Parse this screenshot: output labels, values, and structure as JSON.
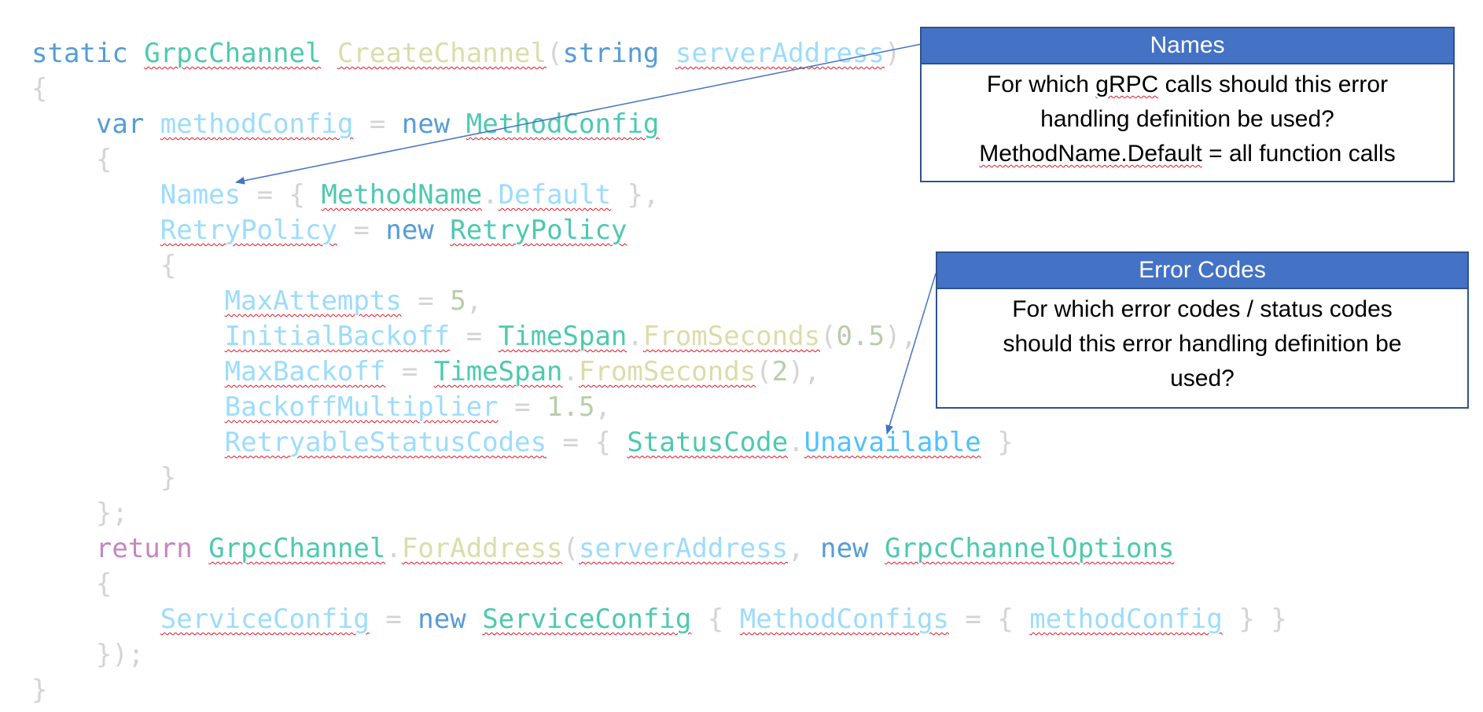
{
  "code": {
    "lines": [
      [
        {
          "t": "static ",
          "c": "kw"
        },
        {
          "t": "GrpcChannel",
          "c": "type",
          "sq": true
        },
        {
          "t": " ",
          "c": "pun"
        },
        {
          "t": "CreateChannel",
          "c": "fn",
          "sq": true
        },
        {
          "t": "(",
          "c": "pun"
        },
        {
          "t": "string",
          "c": "kw"
        },
        {
          "t": " ",
          "c": "pun"
        },
        {
          "t": "serverAddress",
          "c": "var",
          "sq": true
        },
        {
          "t": ")",
          "c": "pun"
        }
      ],
      [
        {
          "t": "{",
          "c": "pun"
        }
      ],
      [
        {
          "t": "    ",
          "c": "pun"
        },
        {
          "t": "var",
          "c": "kw"
        },
        {
          "t": " ",
          "c": "pun"
        },
        {
          "t": "methodConfig",
          "c": "var",
          "sq": true
        },
        {
          "t": " = ",
          "c": "pun"
        },
        {
          "t": "new",
          "c": "kw"
        },
        {
          "t": " ",
          "c": "pun"
        },
        {
          "t": "MethodConfig",
          "c": "type",
          "sq": true
        }
      ],
      [
        {
          "t": "    {",
          "c": "pun"
        }
      ],
      [
        {
          "t": "        ",
          "c": "pun"
        },
        {
          "t": "Names",
          "c": "var"
        },
        {
          "t": " = { ",
          "c": "pun"
        },
        {
          "t": "MethodName",
          "c": "type",
          "sq": true
        },
        {
          "t": ".",
          "c": "pun"
        },
        {
          "t": "Default",
          "c": "var",
          "sq": true
        },
        {
          "t": " },",
          "c": "pun"
        }
      ],
      [
        {
          "t": "        ",
          "c": "pun"
        },
        {
          "t": "RetryPolicy",
          "c": "var",
          "sq": true
        },
        {
          "t": " = ",
          "c": "pun"
        },
        {
          "t": "new",
          "c": "kw"
        },
        {
          "t": " ",
          "c": "pun"
        },
        {
          "t": "RetryPolicy",
          "c": "type",
          "sq": true
        }
      ],
      [
        {
          "t": "        {",
          "c": "pun"
        }
      ],
      [
        {
          "t": "            ",
          "c": "pun"
        },
        {
          "t": "MaxAttempts",
          "c": "var",
          "sq": true
        },
        {
          "t": " = ",
          "c": "pun"
        },
        {
          "t": "5",
          "c": "num"
        },
        {
          "t": ",",
          "c": "pun"
        }
      ],
      [
        {
          "t": "            ",
          "c": "pun"
        },
        {
          "t": "InitialBackoff",
          "c": "var",
          "sq": true
        },
        {
          "t": " = ",
          "c": "pun"
        },
        {
          "t": "TimeSpan",
          "c": "type",
          "sq": true
        },
        {
          "t": ".",
          "c": "pun"
        },
        {
          "t": "FromSeconds",
          "c": "fn",
          "sq": true
        },
        {
          "t": "(",
          "c": "pun"
        },
        {
          "t": "0.5",
          "c": "num"
        },
        {
          "t": "),",
          "c": "pun"
        }
      ],
      [
        {
          "t": "            ",
          "c": "pun"
        },
        {
          "t": "MaxBackoff",
          "c": "var",
          "sq": true
        },
        {
          "t": " = ",
          "c": "pun"
        },
        {
          "t": "TimeSpan",
          "c": "type",
          "sq": true
        },
        {
          "t": ".",
          "c": "pun"
        },
        {
          "t": "FromSeconds",
          "c": "fn",
          "sq": true
        },
        {
          "t": "(",
          "c": "pun"
        },
        {
          "t": "2",
          "c": "num"
        },
        {
          "t": "),",
          "c": "pun"
        }
      ],
      [
        {
          "t": "            ",
          "c": "pun"
        },
        {
          "t": "BackoffMultiplier",
          "c": "var",
          "sq": true
        },
        {
          "t": " = ",
          "c": "pun"
        },
        {
          "t": "1.5",
          "c": "num"
        },
        {
          "t": ",",
          "c": "pun"
        }
      ],
      [
        {
          "t": "            ",
          "c": "pun"
        },
        {
          "t": "RetryableStatusCodes",
          "c": "var",
          "sq": true
        },
        {
          "t": " = { ",
          "c": "pun"
        },
        {
          "t": "StatusCode",
          "c": "type",
          "sq": true
        },
        {
          "t": ".",
          "c": "pun"
        },
        {
          "t": "Unavailable",
          "c": "enumv",
          "sq": true
        },
        {
          "t": " }",
          "c": "pun"
        }
      ],
      [
        {
          "t": "        }",
          "c": "pun"
        }
      ],
      [
        {
          "t": "    };",
          "c": "pun"
        }
      ],
      [
        {
          "t": "    ",
          "c": "pun"
        },
        {
          "t": "return",
          "c": "kwr"
        },
        {
          "t": " ",
          "c": "pun"
        },
        {
          "t": "GrpcChannel",
          "c": "type",
          "sq": true
        },
        {
          "t": ".",
          "c": "pun"
        },
        {
          "t": "ForAddress",
          "c": "fn",
          "sq": true
        },
        {
          "t": "(",
          "c": "pun"
        },
        {
          "t": "serverAddress",
          "c": "var",
          "sq": true
        },
        {
          "t": ", ",
          "c": "pun"
        },
        {
          "t": "new",
          "c": "kw"
        },
        {
          "t": " ",
          "c": "pun"
        },
        {
          "t": "GrpcChannelOptions",
          "c": "type",
          "sq": true
        }
      ],
      [
        {
          "t": "    {",
          "c": "pun"
        }
      ],
      [
        {
          "t": "        ",
          "c": "pun"
        },
        {
          "t": "ServiceConfig",
          "c": "var",
          "sq": true
        },
        {
          "t": " = ",
          "c": "pun"
        },
        {
          "t": "new",
          "c": "kw"
        },
        {
          "t": " ",
          "c": "pun"
        },
        {
          "t": "ServiceConfig",
          "c": "type",
          "sq": true
        },
        {
          "t": " { ",
          "c": "pun"
        },
        {
          "t": "MethodConfigs",
          "c": "var",
          "sq": true
        },
        {
          "t": " = { ",
          "c": "pun"
        },
        {
          "t": "methodConfig",
          "c": "var",
          "sq": true
        },
        {
          "t": " } }",
          "c": "pun"
        }
      ],
      [
        {
          "t": "    });",
          "c": "pun"
        }
      ],
      [
        {
          "t": "}",
          "c": "pun"
        }
      ]
    ]
  },
  "callouts": {
    "names": {
      "title": "Names",
      "body_lines": [
        [
          {
            "t": "For which "
          },
          {
            "t": "gRPC",
            "sq": true
          },
          {
            "t": " calls should this error"
          }
        ],
        [
          {
            "t": "handling definition be used?"
          }
        ],
        [
          {
            "t": "MethodName.Default",
            "sq": true
          },
          {
            "t": " = all function calls"
          }
        ]
      ]
    },
    "error_codes": {
      "title": "Error Codes",
      "body_lines": [
        [
          {
            "t": "For which error codes / status codes"
          }
        ],
        [
          {
            "t": "should this error handling definition be"
          }
        ],
        [
          {
            "t": "used?"
          }
        ]
      ]
    }
  },
  "colors": {
    "callout_header": "#4472c4",
    "callout_border": "#2f528f",
    "arrow": "#4472c4"
  }
}
